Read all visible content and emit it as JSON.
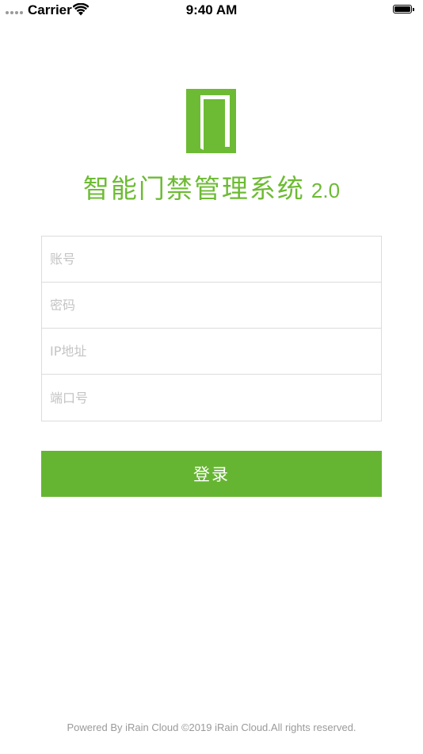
{
  "status_bar": {
    "carrier": "Carrier",
    "time": "9:40 AM",
    "icons": [
      "signal-dots-icon",
      "wifi-icon",
      "battery-icon"
    ],
    "battery_level": 1.0
  },
  "app": {
    "logo_icon": "door-icon",
    "title": "智能门禁管理系统",
    "version": "2.0",
    "accent_color": "#66b532"
  },
  "form": {
    "account_placeholder": "账号",
    "password_placeholder": "密码",
    "ip_placeholder": "IP地址",
    "port_placeholder": "端口号"
  },
  "login_button": {
    "label": "登录"
  },
  "footer": {
    "text": "Powered By iRain Cloud ©2019 iRain Cloud.All rights reserved."
  }
}
